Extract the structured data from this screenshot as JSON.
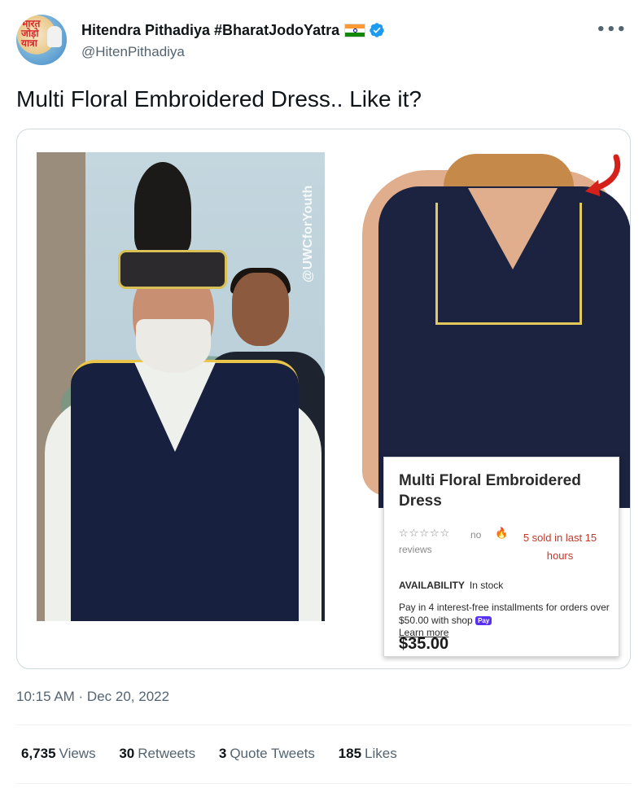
{
  "user": {
    "name": "Hitendra Pithadiya #BharatJodoYatra",
    "handle": "@HitenPithadiya",
    "avatar_text": "भारत जोड़ो यात्रा"
  },
  "tweet": {
    "text": "Multi Floral Embroidered Dress.. Like it?",
    "timestamp": "10:15 AM · Dec 20, 2022"
  },
  "media": {
    "watermark": "@UWCforYouth",
    "product": {
      "title": "Multi Floral Embroidered Dress",
      "stars": "☆☆☆☆☆",
      "reviews": "no reviews",
      "sold": "5 sold in last 15 hours",
      "availability_label": "AVAILABILITY",
      "availability_value": "In stock",
      "installments": "Pay in 4 interest-free installments for orders over $50.00 with shop",
      "shop_badge": "Pay",
      "learn_more": "Learn more",
      "price": "$35.00"
    }
  },
  "stats": [
    {
      "value": "6,735",
      "label": "Views"
    },
    {
      "value": "30",
      "label": "Retweets"
    },
    {
      "value": "3",
      "label": "Quote Tweets"
    },
    {
      "value": "185",
      "label": "Likes"
    }
  ],
  "colors": {
    "verified": "#1d9bf0",
    "arrow": "#d6211b",
    "text_secondary": "#536471"
  },
  "icons": {
    "more": "more-icon",
    "verified": "verified-icon",
    "flag": "flag-icon"
  }
}
